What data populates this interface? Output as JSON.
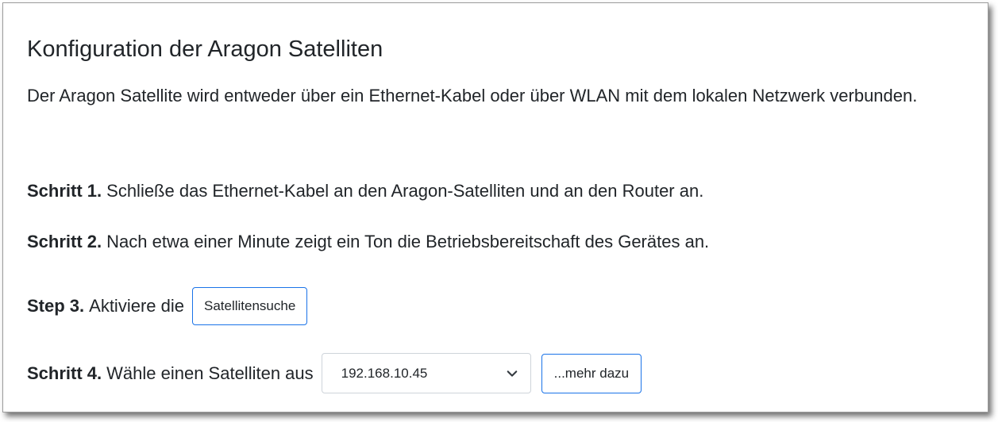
{
  "page": {
    "title": "Konfiguration der Aragon Satelliten",
    "intro": "Der Aragon Satellite wird entweder über ein Ethernet-Kabel oder über WLAN mit dem lokalen Netzwerk verbunden."
  },
  "steps": [
    {
      "label": "Schritt 1.",
      "text": "Schließe das Ethernet-Kabel an den Aragon-Satelliten und an den Router an."
    },
    {
      "label": "Schritt 2.",
      "text": "Nach etwa einer Minute zeigt ein Ton die Betriebsbereitschaft des Gerätes an."
    },
    {
      "label": "Step 3.",
      "text": "Aktiviere die",
      "button": "Satellitensuche"
    },
    {
      "label": "Schritt 4.",
      "text": "Wähle einen Satelliten aus",
      "select_value": "192.168.10.45",
      "button": "...mehr dazu"
    }
  ],
  "icons": {
    "select_arrow": "chevron-down-icon"
  },
  "colors": {
    "button_border": "#1a73e8",
    "text": "#212529",
    "select_border": "#ced4da"
  }
}
